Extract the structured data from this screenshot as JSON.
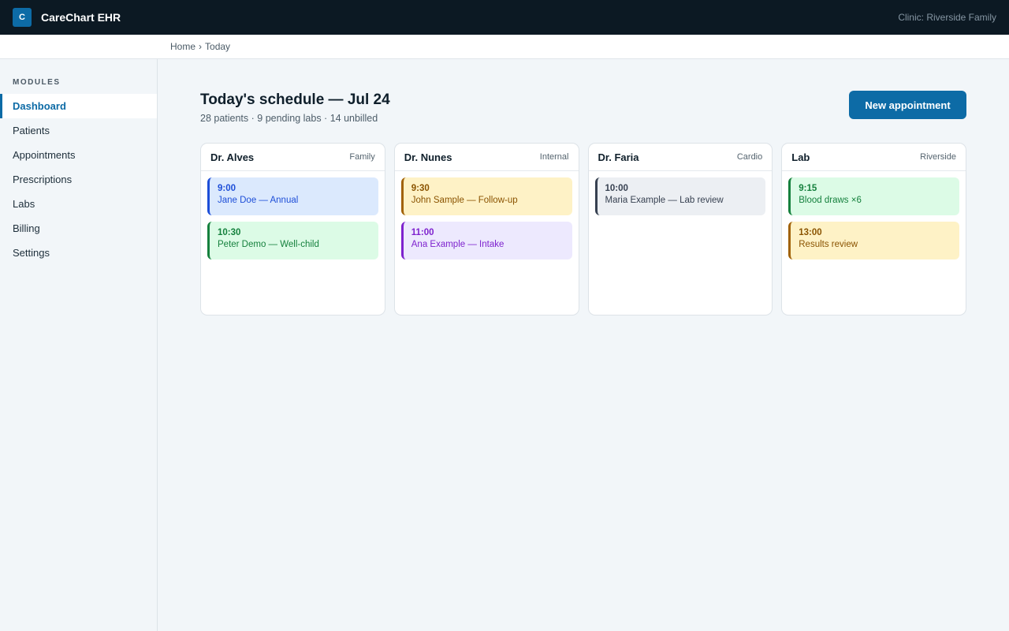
{
  "app": {
    "logo_letter": "C",
    "title": "CareChart EHR",
    "clinic": "Clinic: Riverside Family"
  },
  "breadcrumb": {
    "home": "Home",
    "separator": "›",
    "current": "Today"
  },
  "sidebar": {
    "heading": "MODULES",
    "items": [
      {
        "label": "Dashboard",
        "active": true
      },
      {
        "label": "Patients"
      },
      {
        "label": "Appointments"
      },
      {
        "label": "Prescriptions"
      },
      {
        "label": "Labs"
      },
      {
        "label": "Billing"
      },
      {
        "label": "Settings"
      }
    ]
  },
  "page": {
    "title": "Today's schedule — Jul 24",
    "subtitle": "28 patients · 9 pending labs · 14 unbilled",
    "new_button": "New appointment"
  },
  "columns": [
    {
      "name": "Dr. Alves",
      "tag": "Family",
      "appointments": [
        {
          "time": "9:00",
          "desc": "Jane Doe — Annual",
          "color": "blue"
        },
        {
          "time": "10:30",
          "desc": "Peter Demo — Well-child",
          "color": "green"
        }
      ]
    },
    {
      "name": "Dr. Nunes",
      "tag": "Internal",
      "appointments": [
        {
          "time": "9:30",
          "desc": "John Sample — Follow-up",
          "color": "yellow"
        },
        {
          "time": "11:00",
          "desc": "Ana Example — Intake",
          "color": "purple"
        }
      ]
    },
    {
      "name": "Dr. Faria",
      "tag": "Cardio",
      "appointments": [
        {
          "time": "10:00",
          "desc": "Maria Example — Lab review",
          "color": "gray"
        }
      ]
    },
    {
      "name": "Lab",
      "tag": "Riverside",
      "appointments": [
        {
          "time": "9:15",
          "desc": "Blood draws ×6",
          "color": "green"
        },
        {
          "time": "13:00",
          "desc": "Results review",
          "color": "yellow"
        }
      ]
    }
  ],
  "colors": {
    "accent": "#0d6ba6",
    "topbar": "#0c1923"
  }
}
